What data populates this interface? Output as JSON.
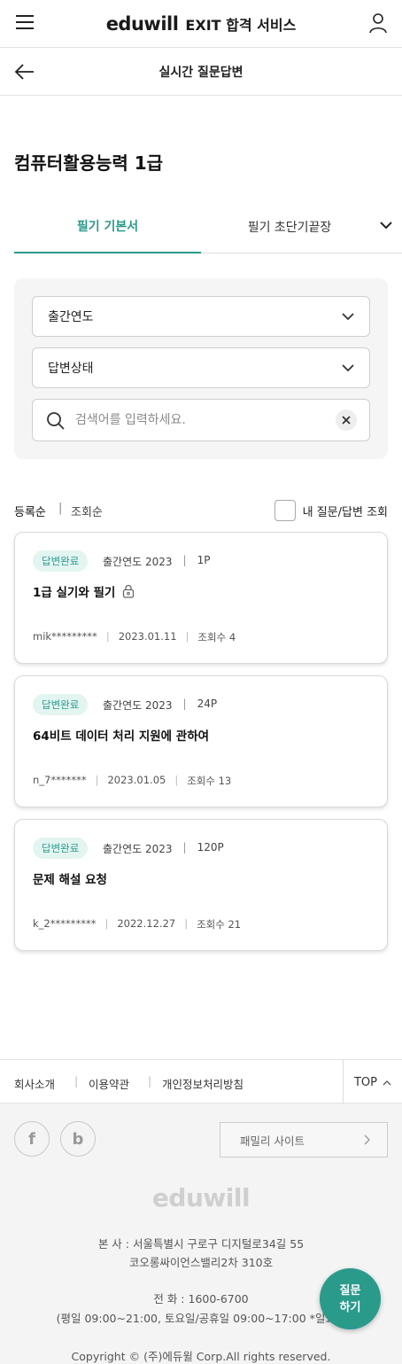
{
  "header": {
    "logo": "eduwill",
    "service": "EXIT 합격 서비스",
    "menu_icon": "hamburger-menu-icon",
    "user_icon": "user-icon"
  },
  "subheader": {
    "title": "실시간 질문답변",
    "back_icon": "arrow-left-icon"
  },
  "page_title": "컴퓨터활용능력 1급",
  "tabs": [
    {
      "label": "필기 기본서",
      "active": true
    },
    {
      "label": "필기 초단기끝장",
      "active": false
    }
  ],
  "filters": {
    "year_select": "출간연도",
    "status_select": "답변상태",
    "search_placeholder": "검색어를 입력하세요."
  },
  "sort": {
    "option_1": "등록순",
    "option_2": "조회순",
    "my_questions_label": "내 질문/답변 조회"
  },
  "posts": [
    {
      "badge": "답변완료",
      "year": "출간연도 2023",
      "page": "1P",
      "title": "1급 실기와 필기",
      "locked": true,
      "author": "mik*********",
      "date": "2023.01.11",
      "views": "조회수 4"
    },
    {
      "badge": "답변완료",
      "year": "출간연도 2023",
      "page": "24P",
      "title": "64비트 데이터 처리 지원에 관하여",
      "locked": false,
      "author": "n_7*******",
      "date": "2023.01.05",
      "views": "조회수 13"
    },
    {
      "badge": "답변완료",
      "year": "출간연도 2023",
      "page": "120P",
      "title": "문제 해설 요청",
      "locked": false,
      "author": "k_2*********",
      "date": "2022.12.27",
      "views": "조회수 21"
    }
  ],
  "footer": {
    "links": [
      "회사소개",
      "이용약관",
      "개인정보처리방침"
    ],
    "top_label": "TOP",
    "social": [
      "f",
      "b"
    ],
    "family_site": "패밀리 사이트",
    "logo": "eduwill",
    "address_line1": "본 사 : 서울특별시 구로구 디지털로34길 55",
    "address_line2": "코오롱싸이언스밸리2차 310호",
    "tel_line1": "전 화 : 1600-6700",
    "tel_line2": "(평일 09:00~21:00, 토요일/공휴일 09:00~17:00 *일요일",
    "copyright": "Copyright © (주)에듀윌 Corp.All rights reserved."
  },
  "fab": {
    "line1": "질문",
    "line2": "하기"
  },
  "colors": {
    "accent": "#2a9a8b",
    "badge_bg": "#e3f5f1",
    "logo_accent": "#f7b300"
  }
}
